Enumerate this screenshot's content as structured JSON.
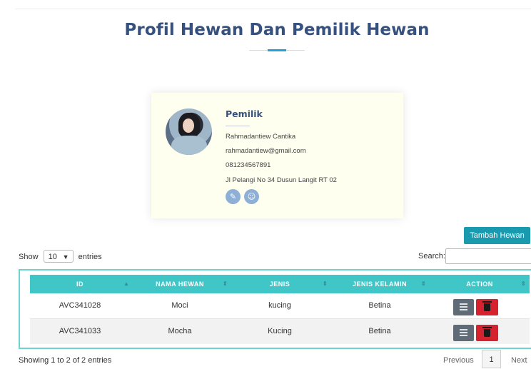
{
  "page": {
    "title": "Profil Hewan Dan Pemilik Hewan"
  },
  "owner": {
    "heading": "Pemilik",
    "name": "Rahmadantiew Cantika",
    "email": "rahmadantiew@gmail.com",
    "phone": "081234567891",
    "address": "Jl Pelangi No 34 Dusun Langit RT 02",
    "actions": [
      {
        "icon": "user-edit-icon",
        "glyph": "✎"
      },
      {
        "icon": "user-icon",
        "glyph": "☺"
      }
    ]
  },
  "toolbar": {
    "add_button": "Tambah Hewan"
  },
  "table_controls": {
    "show_label": "Show",
    "page_size": "10",
    "entries_label": "entries",
    "search_label": "Search:",
    "search_value": ""
  },
  "table": {
    "headers": [
      "ID",
      "NAMA HEWAN",
      "JENIS",
      "JENIS KELAMIN",
      "ACTION"
    ],
    "rows": [
      {
        "id": "AVC341028",
        "nama": "Moci",
        "jenis": "kucing",
        "kelamin": "Betina"
      },
      {
        "id": "AVC341033",
        "nama": "Mocha",
        "jenis": "Kucing",
        "kelamin": "Betina"
      }
    ]
  },
  "footer": {
    "info": "Showing 1 to 2 of 2 entries",
    "prev": "Previous",
    "page": "1",
    "next": "Next"
  },
  "colors": {
    "title": "#37517e",
    "accent": "#1ea0d8",
    "header_bg": "#41c6c7",
    "add_button": "#1a9aae",
    "edit_button": "#5f6c78",
    "delete_button": "#d6212f"
  }
}
